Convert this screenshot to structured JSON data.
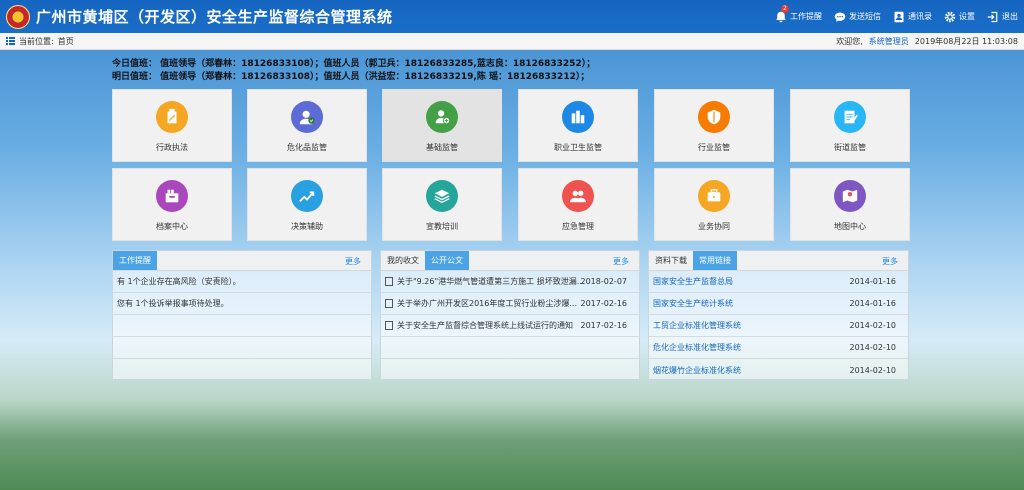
{
  "header": {
    "title": "广州市黄埔区（开发区）安全生产监督综合管理系统",
    "actions": [
      {
        "label": "工作提醒",
        "icon": "bell-icon",
        "badge": "2"
      },
      {
        "label": "发送短信",
        "icon": "message-icon"
      },
      {
        "label": "通讯录",
        "icon": "contacts-icon"
      },
      {
        "label": "设置",
        "icon": "gear-icon"
      },
      {
        "label": "退出",
        "icon": "logout-icon"
      }
    ]
  },
  "breadcrumb": {
    "label": "当前位置:",
    "current": "首页",
    "welcome": "欢迎您,",
    "user": "系统管理员",
    "datetime": "2019年08月22日 11:03:08"
  },
  "duty": {
    "today": "今日值班：  值班领导（郑春林：18126833108）；值班人员（郭卫兵：18126833285,蓝志良：18126833252）；",
    "tomorrow": "明日值班：  值班领导（郑春林：18126833108）；值班人员（洪益宏：18126833219,陈 瑶：18126833212）；"
  },
  "tiles": [
    {
      "label": "行政执法",
      "icon": "law-enforcement-icon",
      "color": "#f5a623"
    },
    {
      "label": "危化品监管",
      "icon": "hazardous-chemicals-icon",
      "color": "#5c6bd6"
    },
    {
      "label": "基础监管",
      "icon": "basic-supervision-icon",
      "color": "#43a047"
    },
    {
      "label": "职业卫生监管",
      "icon": "occupational-health-icon",
      "color": "#1e88e5"
    },
    {
      "label": "行业监管",
      "icon": "industry-supervision-icon",
      "color": "#f57c00"
    },
    {
      "label": "街道监管",
      "icon": "street-supervision-icon",
      "color": "#29b6f6"
    },
    {
      "label": "档案中心",
      "icon": "archive-icon",
      "color": "#ab47bc"
    },
    {
      "label": "决策辅助",
      "icon": "decision-support-icon",
      "color": "#29a0e0"
    },
    {
      "label": "宣教培训",
      "icon": "training-icon",
      "color": "#26a69a"
    },
    {
      "label": "应急管理",
      "icon": "emergency-icon",
      "color": "#ef5350"
    },
    {
      "label": "业务协同",
      "icon": "collaboration-icon",
      "color": "#f5a623"
    },
    {
      "label": "地图中心",
      "icon": "map-icon",
      "color": "#7e57c2"
    }
  ],
  "panels": {
    "work": {
      "tab": "工作提醒",
      "more": "更多",
      "rows": [
        "有 1个企业存在高风险（安责险）。",
        "您有 1个投诉举报事项待处理。"
      ]
    },
    "docs": {
      "tabs": [
        "我的收文",
        "公开公文"
      ],
      "more": "更多",
      "rows": [
        {
          "title": "关于\"9.26\"港华燃气管道遭第三方施工 损坏致泄漏...",
          "date": "2018-02-07"
        },
        {
          "title": "关于举办广州开发区2016年度工贸行业粉尘涉爆...",
          "date": "2017-02-16"
        },
        {
          "title": "关于安全生产监督综合管理系统上线试运行的通知",
          "date": "2017-02-16"
        }
      ]
    },
    "downloads": {
      "tabs": [
        "资料下载",
        "常用链接"
      ],
      "more": "更多",
      "rows": [
        {
          "title": "国家安全生产监督总局",
          "date": "2014-01-16"
        },
        {
          "title": "国家安全生产统计系统",
          "date": "2014-01-16"
        },
        {
          "title": "工贸企业标准化管理系统",
          "date": "2014-02-10"
        },
        {
          "title": "危化企业标准化管理系统",
          "date": "2014-02-10"
        },
        {
          "title": "烟花爆竹企业标准化系统",
          "date": "2014-02-10"
        }
      ]
    }
  }
}
